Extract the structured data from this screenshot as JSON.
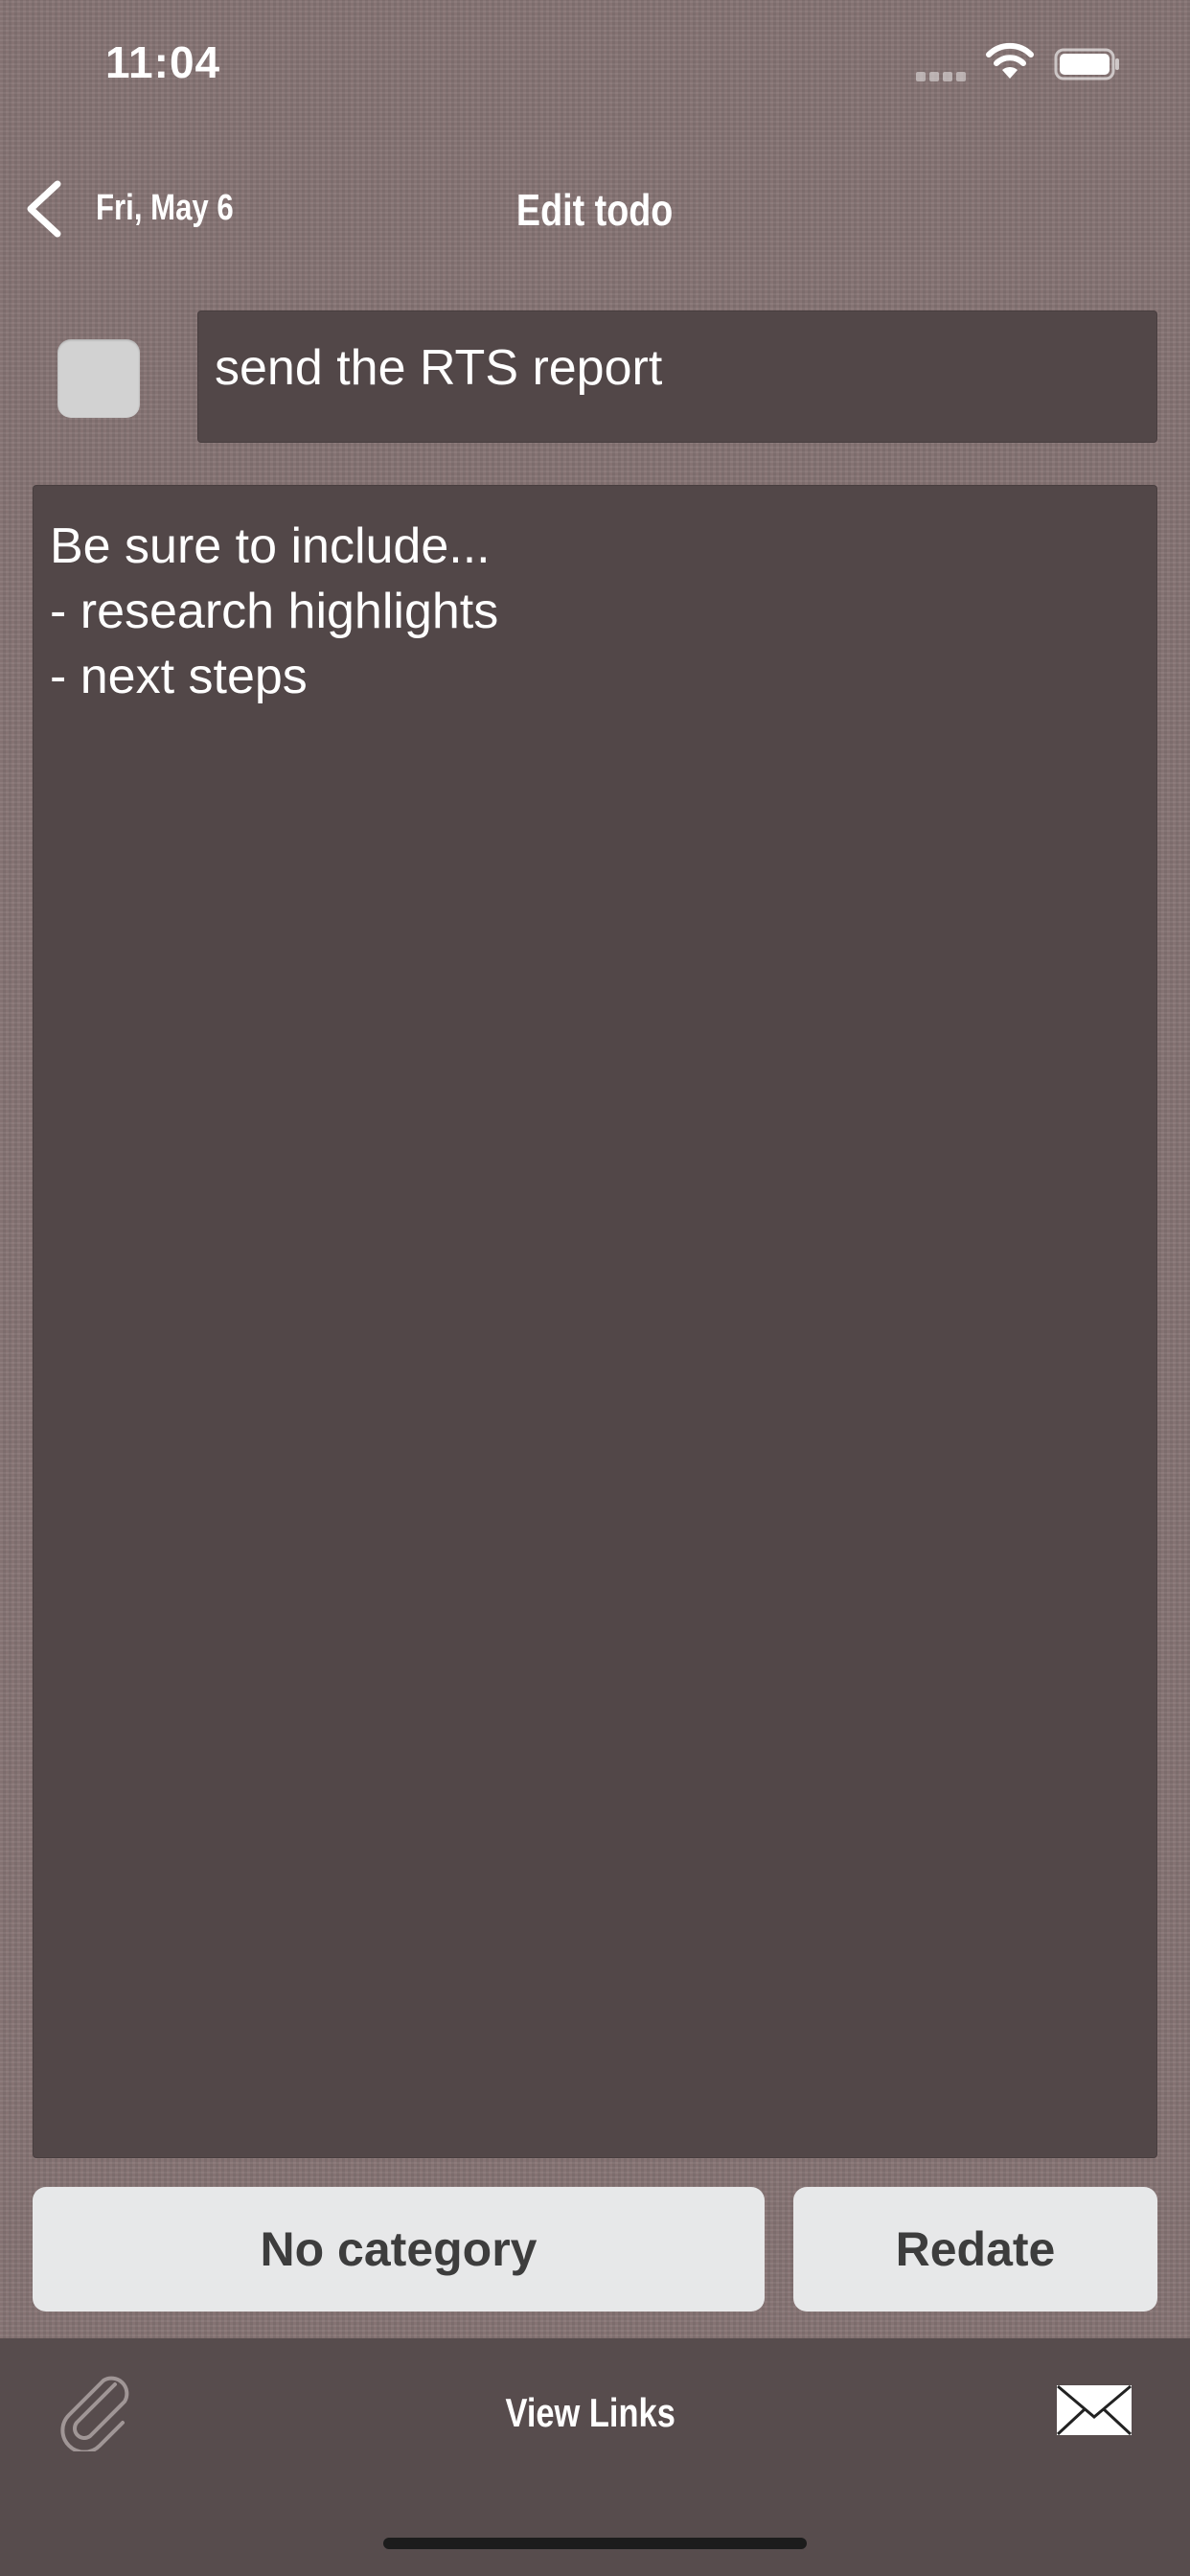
{
  "status_bar": {
    "time": "11:04"
  },
  "nav": {
    "back_label": "Fri, May 6",
    "title": "Edit todo"
  },
  "todo": {
    "completed": false,
    "title": "send the RTS report",
    "notes": "Be sure to include...\n- research highlights\n- next steps"
  },
  "buttons": {
    "category": "No category",
    "redate": "Redate"
  },
  "toolbar": {
    "links_label": "View Links",
    "attach_icon": "paperclip-icon",
    "mail_icon": "envelope-icon"
  },
  "colors": {
    "background": "#857373",
    "field": "#524748",
    "button": "#e7e8e9",
    "toolbar": "#574c4d"
  }
}
